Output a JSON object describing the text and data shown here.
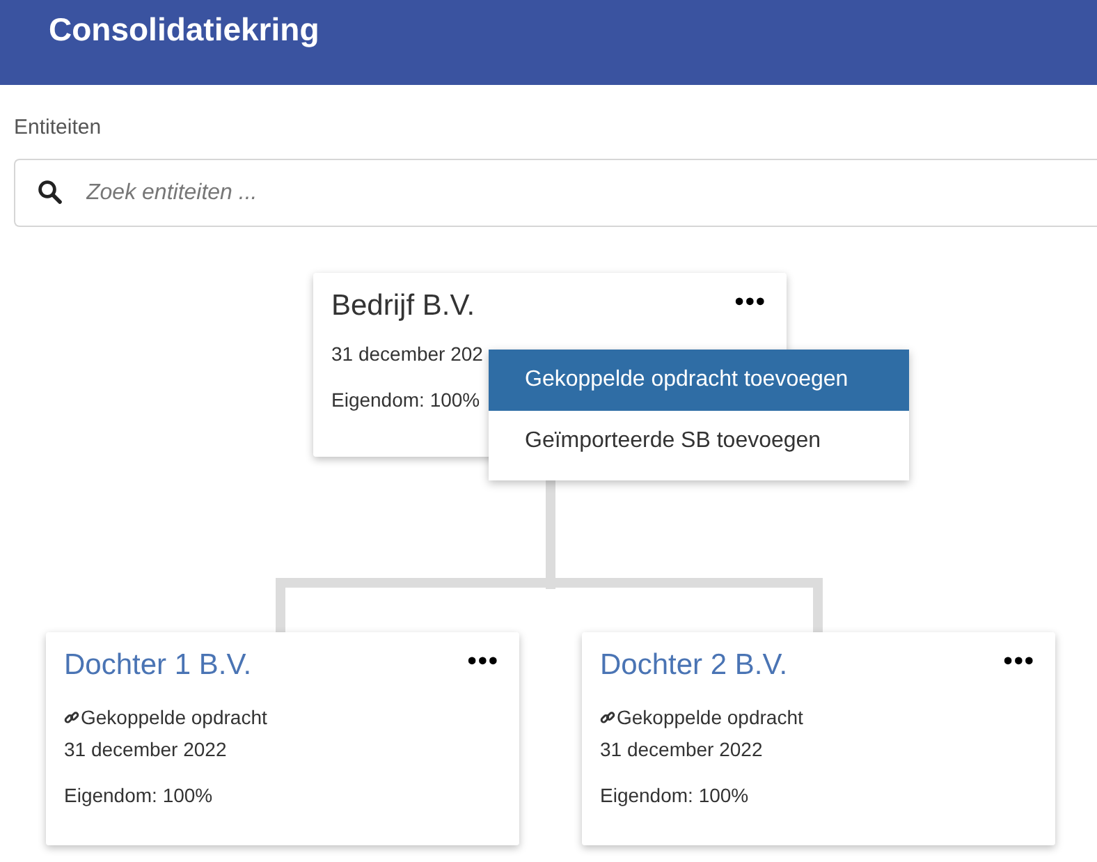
{
  "header": {
    "title": "Consolidatiekring"
  },
  "entities_label": "Entiteiten",
  "search": {
    "placeholder": "Zoek entiteiten ..."
  },
  "nodes": [
    {
      "kind": "root",
      "title": "Bedrijf B.V.",
      "menu_button": "•••",
      "date": "31 december 202",
      "ownership": "Eigendom: 100%"
    },
    {
      "kind": "child",
      "title": "Dochter 1 B.V.",
      "menu_button": "•••",
      "linked": "Gekoppelde opdracht",
      "date": "31 december 2022",
      "ownership": "Eigendom: 100%"
    },
    {
      "kind": "child",
      "title": "Dochter 2 B.V.",
      "menu_button": "•••",
      "linked": "Gekoppelde opdracht",
      "date": "31 december 2022",
      "ownership": "Eigendom: 100%"
    }
  ],
  "menu": {
    "items": [
      {
        "label": "Gekoppelde opdracht toevoegen",
        "selected": true
      },
      {
        "label": "Geïmporteerde SB toevoegen",
        "selected": false
      }
    ]
  }
}
